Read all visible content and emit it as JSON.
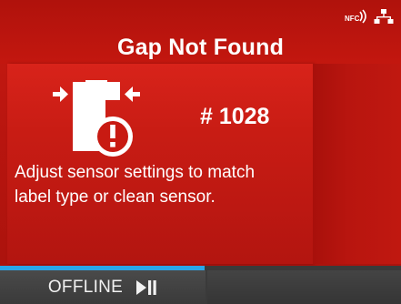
{
  "status": {
    "nfc_icon": "nfc-icon",
    "network_icon": "wired-network-icon"
  },
  "header": {
    "title": "Gap Not Found"
  },
  "error": {
    "icon": "sensor-gap-warning-icon",
    "code": "# 1028",
    "message_line1": "Adjust sensor settings to match",
    "message_line2": "label type or clean sensor."
  },
  "footer": {
    "progress_fraction": 0.51,
    "softkey_left_label": "OFFLINE",
    "softkey_left_icon": "play-pause-icon",
    "softkey_right_label": ""
  },
  "colors": {
    "accent_progress": "#2aa6e8",
    "error_red": "#c81a12"
  }
}
